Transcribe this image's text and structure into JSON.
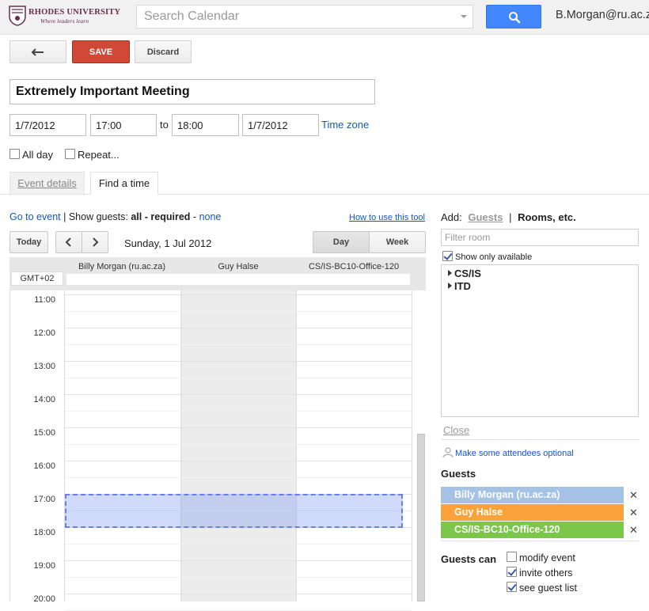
{
  "header": {
    "logo_name": "RHODES UNIVERSITY",
    "logo_tagline": "Where leaders learn",
    "search_placeholder": "Search Calendar",
    "user_email": "B.Morgan@ru.ac.za"
  },
  "toolbar": {
    "save_label": "SAVE",
    "discard_label": "Discard"
  },
  "event": {
    "title": "Extremely Important Meeting",
    "start_date": "1/7/2012",
    "start_time": "17:00",
    "to_label": "to",
    "end_time": "18:00",
    "end_date": "1/7/2012",
    "timezone_link": "Time zone",
    "all_day_label": "All day",
    "all_day_checked": false,
    "repeat_label": "Repeat...",
    "repeat_checked": false
  },
  "tabs": [
    {
      "label": "Event details",
      "active": false
    },
    {
      "label": "Find a time",
      "active": true
    }
  ],
  "find_time": {
    "go_to_event": "Go to event",
    "show_guests_label": "| Show guests:",
    "all_label": "all",
    "dash1": "-",
    "required_label": "required",
    "dash2": "-",
    "none_label": "none",
    "how_to_link": "How to use this tool",
    "today_label": "Today",
    "prev_icon": "chevron-left-icon",
    "next_icon": "chevron-right-icon",
    "date_label": "Sunday, 1 Jul 2012",
    "day_label": "Day",
    "week_label": "Week",
    "timezone": "GMT+02",
    "columns": [
      "Billy Morgan (ru.ac.za)",
      "Guy Halse",
      "CS/IS-BC10-Office-120"
    ],
    "hours": [
      "11:00",
      "12:00",
      "13:00",
      "14:00",
      "15:00",
      "16:00",
      "17:00",
      "18:00",
      "19:00",
      "20:00"
    ],
    "busy_column": "Guy Halse",
    "selected_start": "17:00",
    "selected_end": "18:00"
  },
  "right_panel": {
    "add_label": "Add:",
    "guests_tab": "Guests",
    "separator": "|",
    "rooms_tab": "Rooms, etc.",
    "filter_placeholder": "Filter room",
    "show_only_available_label": "Show only available",
    "show_only_available_checked": true,
    "room_groups": [
      "CS/IS",
      "ITD"
    ],
    "close_link": "Close",
    "optional_link": "Make some attendees optional",
    "guests_heading": "Guests",
    "guests": [
      {
        "name": "Billy Morgan (ru.ac.za)",
        "color": "#a4c2e6"
      },
      {
        "name": "Guy Halse",
        "color": "#fba33a"
      },
      {
        "name": "CS/IS-BC10-Office-120",
        "color": "#7ac74a"
      }
    ],
    "guests_can_label": "Guests can",
    "permissions": [
      {
        "label": "modify event",
        "checked": false
      },
      {
        "label": "invite others",
        "checked": true
      },
      {
        "label": "see guest list",
        "checked": true
      }
    ]
  },
  "colors": {
    "save_button": "#d14836",
    "search_button": "#4387fd",
    "link": "#1155cc",
    "selection": "#6a7fe8"
  }
}
